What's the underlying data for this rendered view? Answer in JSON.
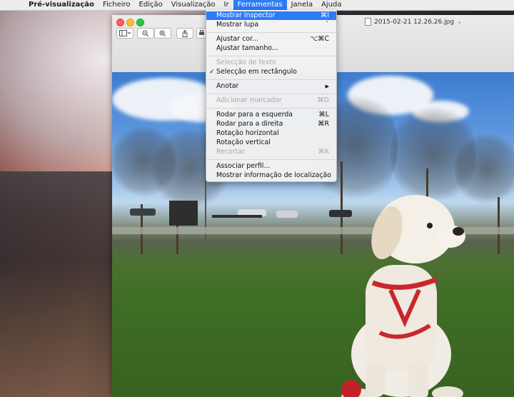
{
  "menubar": {
    "app": "Pré-visualização",
    "items": [
      "Ficheiro",
      "Edição",
      "Visualização",
      "Ir",
      "Ferramentas",
      "Janela",
      "Ajuda"
    ],
    "active": "Ferramentas"
  },
  "window": {
    "title": "2015-02-21 12.26.26.jpg",
    "title_chevron": "⌄"
  },
  "menu": {
    "mostrar_inspector": {
      "label": "Mostrar Inspector",
      "shortcut": "⌘I"
    },
    "mostrar_lupa": {
      "label": "Mostrar lupa",
      "shortcut": "`"
    },
    "ajustar_cor": {
      "label": "Ajustar cor...",
      "shortcut": "⌥⌘C"
    },
    "ajustar_tamanho": {
      "label": "Ajustar tamanho..."
    },
    "seleccao_texto": {
      "label": "Selecção de texto"
    },
    "seleccao_rectangulo": {
      "label": "Selecção em rectângulo",
      "check": "✓"
    },
    "anotar": {
      "label": "Anotar",
      "arrow": "▶"
    },
    "adicionar_marcador": {
      "label": "Adicionar marcador",
      "shortcut": "⌘D"
    },
    "rodar_esquerda": {
      "label": "Rodar para a esquerda",
      "shortcut": "⌘L"
    },
    "rodar_direita": {
      "label": "Rodar para a direita",
      "shortcut": "⌘R"
    },
    "rotacao_horizontal": {
      "label": "Rotação horizontal"
    },
    "rotacao_vertical": {
      "label": "Rotação vertical"
    },
    "recortar": {
      "label": "Recortar",
      "shortcut": "⌘K"
    },
    "associar_perfil": {
      "label": "Associar perfil..."
    },
    "mostrar_localizacao": {
      "label": "Mostrar informação de localização"
    }
  },
  "toolbar": {
    "sidebar_icon": "sidebar-toggle-icon",
    "zoom_out_icon": "zoom-out-icon",
    "zoom_in_icon": "zoom-in-icon",
    "share_icon": "share-icon",
    "print_icon": "print-icon"
  },
  "colors": {
    "accent": "#2e7bf6",
    "menubar_bg": "#ededed"
  }
}
